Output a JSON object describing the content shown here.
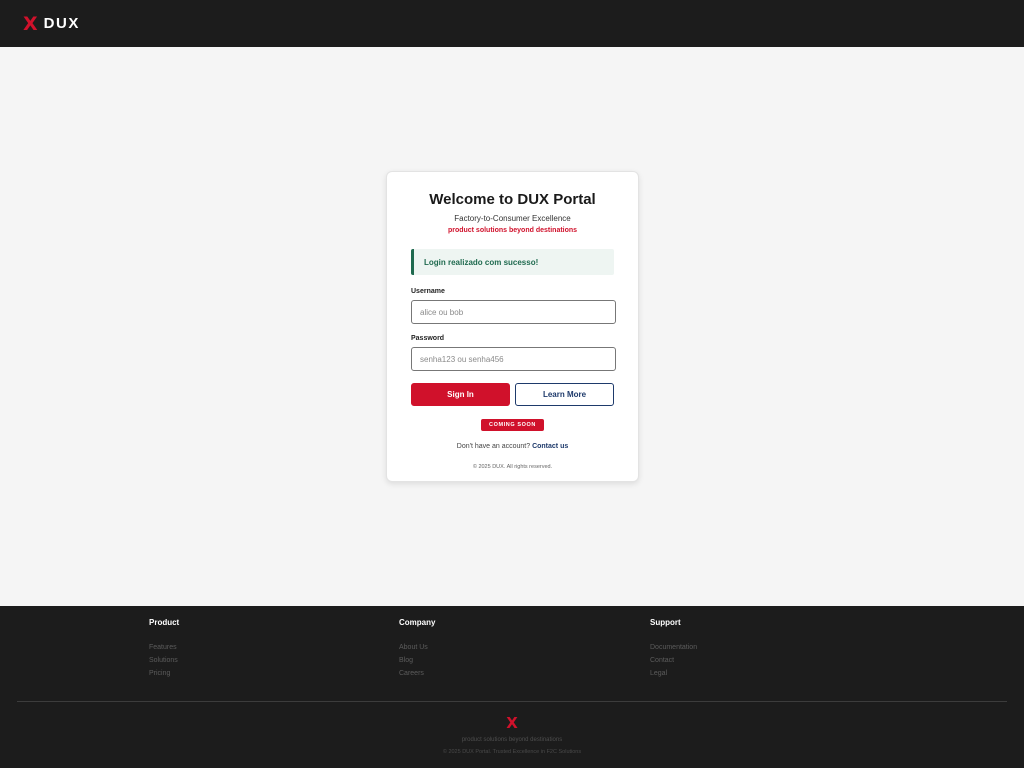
{
  "header": {
    "logo_mark": "X",
    "logo_text": "DUX"
  },
  "card": {
    "title": "Welcome to DUX Portal",
    "subtitle": "Factory-to-Consumer Excellence",
    "tagline": "product solutions beyond destinations",
    "alert": "Login realizado com sucesso!",
    "username_label": "Username",
    "username_placeholder": "alice ou bob",
    "password_label": "Password",
    "password_placeholder": "senha123 ou senha456",
    "sign_in_label": "Sign In",
    "learn_more_label": "Learn More",
    "badge": "COMING SOON",
    "signup_text": "Don't have an account?",
    "contact_link": "Contact us",
    "copyright": "© 2025 DUX. All rights reserved."
  },
  "footer": {
    "columns": [
      {
        "heading": "Product",
        "links": [
          "Features",
          "Solutions",
          "Pricing"
        ]
      },
      {
        "heading": "Company",
        "links": [
          "About Us",
          "Blog",
          "Careers"
        ]
      },
      {
        "heading": "Support",
        "links": [
          "Documentation",
          "Contact",
          "Legal"
        ]
      }
    ],
    "logo_mark": "X",
    "tagline": "product solutions beyond destinations",
    "copyright": "© 2025 DUX Portal. Trusted Excellence in F2C Solutions"
  },
  "colors": {
    "brand_red": "#d0112b",
    "dark_bg": "#1c1c1c",
    "navy": "#1e3a6b",
    "success_green": "#1f6a4f"
  }
}
